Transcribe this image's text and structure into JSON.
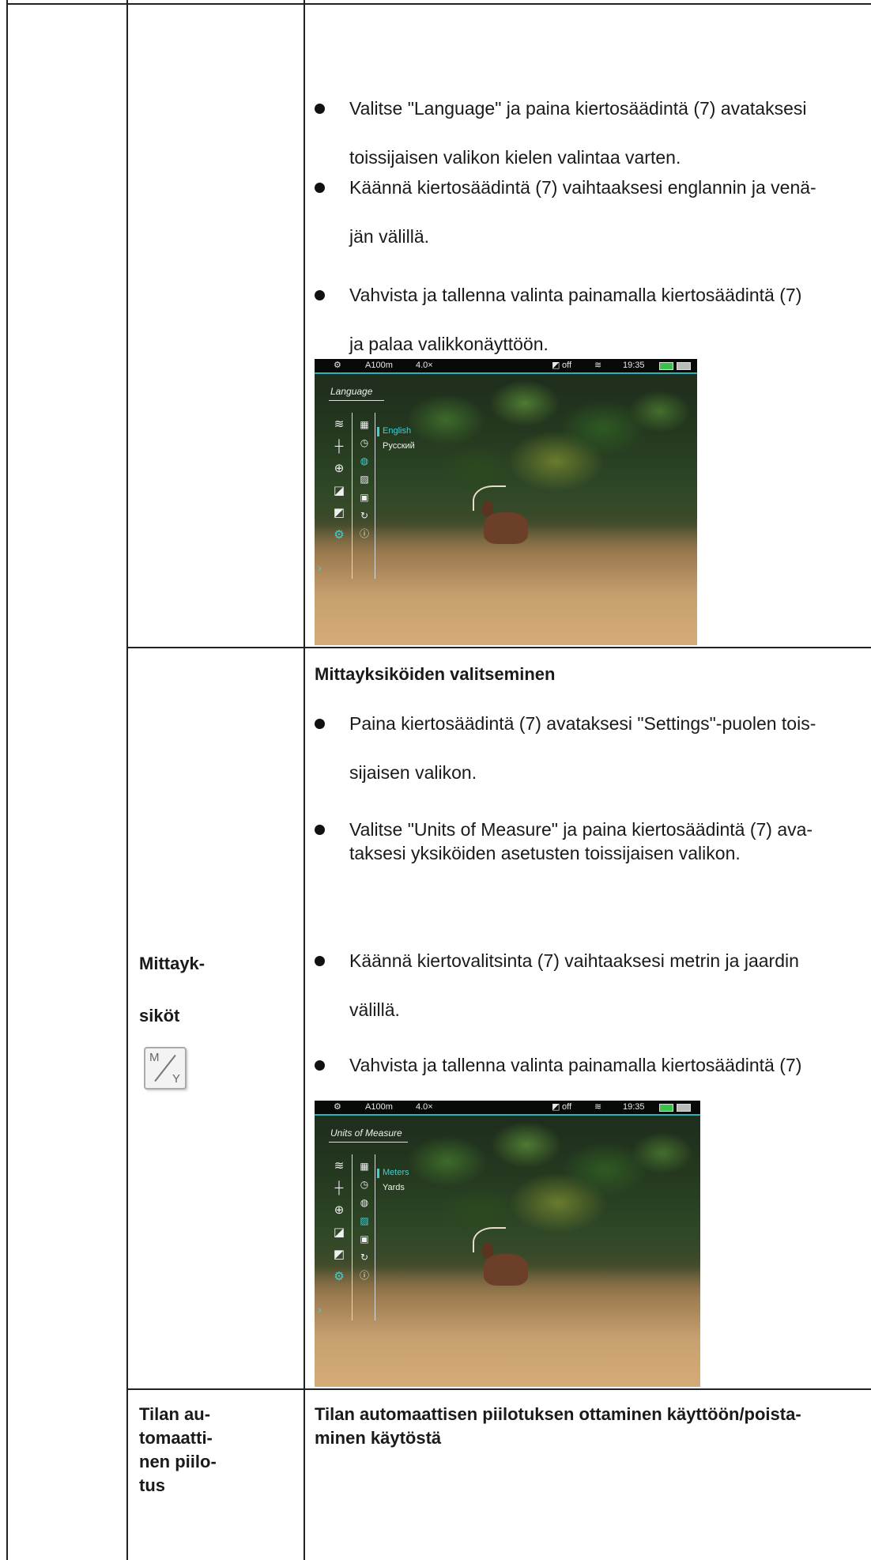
{
  "section_top": {
    "bullets": [
      "Valitse \"Language\" ja paina kiertosäädintä (7) avataksesi",
      "toissijaisen valikon kielen valintaa varten.",
      "Käännä kiertosäädintä (7) vaihtaaksesi englannin ja venä-",
      "jän välillä.",
      "Vahvista ja tallenna valinta painamalla kiertosäädintä (7)",
      "ja palaa valikkonäyttöön."
    ]
  },
  "screen1": {
    "status": {
      "gear": "⚙",
      "range": "A100m",
      "zoom": "4.0×",
      "pip": "off",
      "time": "19:35"
    },
    "panel_title": "Language",
    "options": [
      "English",
      "Русский"
    ],
    "selected_option": "English"
  },
  "section_units": {
    "label_line1": "Mittayk-",
    "label_line2": "siköt",
    "icon_m": "M",
    "icon_y": "Y",
    "heading": "Mittayksiköiden valitseminen",
    "bullets": [
      "Paina kiertosäädintä (7) avataksesi \"Settings\"-puolen tois-",
      "sijaisen valikon.",
      "Valitse \"Units of Measure\" ja paina kiertosäädintä (7) ava-",
      "taksesi yksiköiden asetusten toissijaisen valikon.",
      "Käännä kiertovalitsinta (7) vaihtaaksesi metrin ja jaardin",
      "välillä.",
      "Vahvista ja tallenna valinta painamalla kiertosäädintä (7)"
    ]
  },
  "screen2": {
    "status": {
      "gear": "⚙",
      "range": "A100m",
      "zoom": "4.0×",
      "pip": "off",
      "time": "19:35"
    },
    "panel_title": "Units of Measure",
    "options": [
      "Meters",
      "Yards"
    ],
    "selected_option": "Meters"
  },
  "section_hide": {
    "label_lines": [
      "Tilan au-",
      "tomaatti-",
      "nen piilo-",
      "tus"
    ],
    "heading_lines": [
      "Tilan automaattisen piilotuksen ottaminen käyttöön/poista-",
      "minen käytöstä"
    ]
  },
  "colors": {
    "accent": "#3fd1d6",
    "rule": "#222222"
  }
}
